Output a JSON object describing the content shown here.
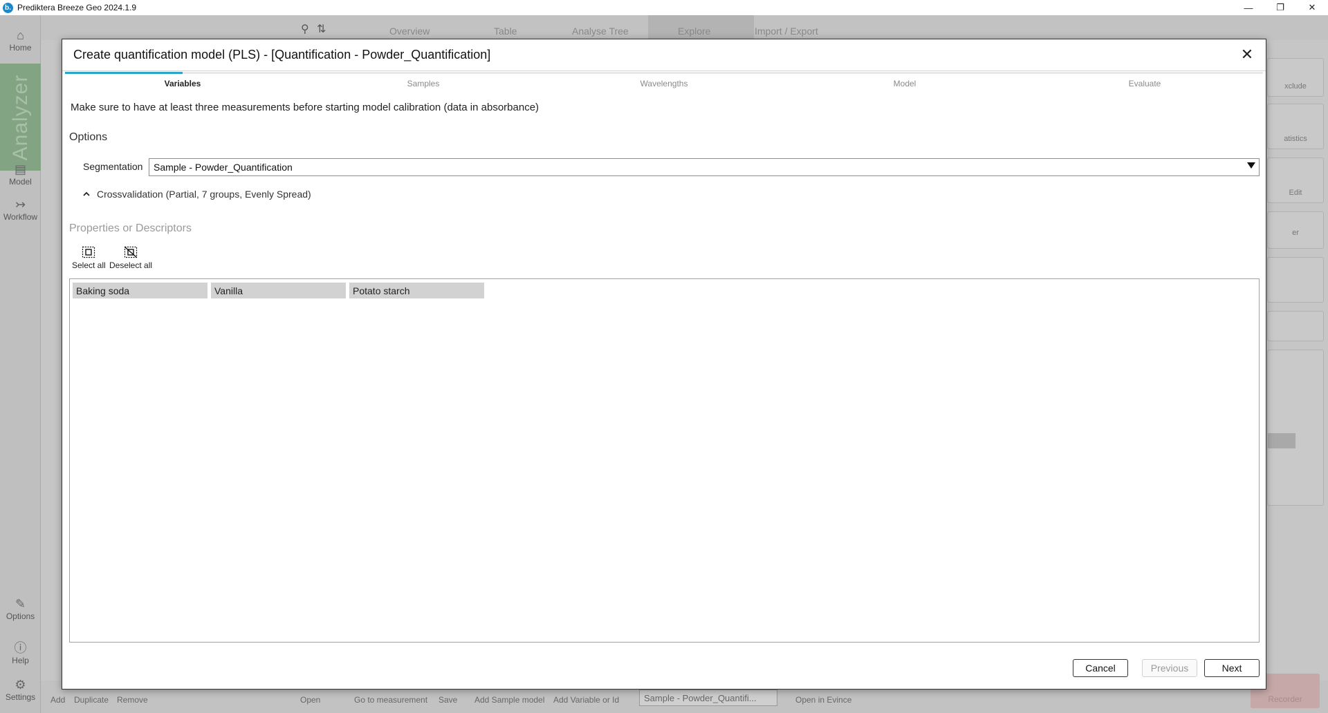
{
  "app": {
    "window_title": "Prediktera Breeze Geo 2024.1.9",
    "logo_letter": "b."
  },
  "window_controls": {
    "minimize": "—",
    "maximize": "❐",
    "close": "✕"
  },
  "left_rail": {
    "home": "Home",
    "analyzer": "Analyzer",
    "model": "Model",
    "workflow": "Workflow",
    "options": "Options",
    "help": "Help",
    "settings": "Settings"
  },
  "background": {
    "tabs": [
      "Overview",
      "Table",
      "Analyse Tree",
      "Explore",
      "Import / Export"
    ],
    "bottom_labels": [
      "Add",
      "Duplicate",
      "Remove",
      "Open",
      "Go to measurement",
      "Save",
      "Add Sample model",
      "Add Variable or Id",
      "Sample - Powder_Quantifi...",
      "Open in Evince",
      "Recorder"
    ],
    "right_cards": [
      "xclude",
      "atistics",
      "Edit",
      "er"
    ]
  },
  "dialog": {
    "title": "Create quantification model (PLS) - [Quantification - Powder_Quantification]",
    "close_glyph": "✕",
    "steps": [
      {
        "label": "Variables",
        "active": true
      },
      {
        "label": "Samples",
        "active": false
      },
      {
        "label": "Wavelengths",
        "active": false
      },
      {
        "label": "Model",
        "active": false
      },
      {
        "label": "Evaluate",
        "active": false
      }
    ],
    "info_text": "Make sure to have at least three measurements before starting model calibration (data in absorbance)",
    "options_heading": "Options",
    "segmentation": {
      "label": "Segmentation",
      "value": "Sample - Powder_Quantification"
    },
    "crossvalidation_label": "Crossvalidation (Partial, 7 groups, Evenly Spread)",
    "properties_heading": "Properties or Descriptors",
    "select_all": "Select all",
    "deselect_all": "Deselect all",
    "properties": [
      "Baking soda",
      "Vanilla",
      "Potato starch"
    ],
    "buttons": {
      "cancel": "Cancel",
      "previous": "Previous",
      "next": "Next"
    }
  },
  "colors": {
    "accent": "#2ba6cb",
    "analyzer_green": "#83a482"
  }
}
